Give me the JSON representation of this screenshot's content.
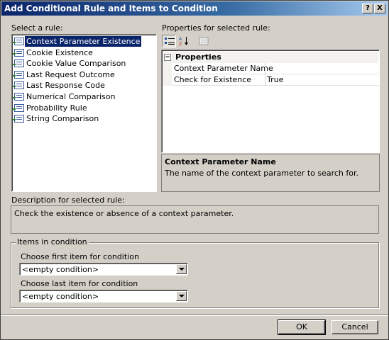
{
  "window": {
    "title": "Add Conditional Rule and Items to Condition",
    "help_button": "?",
    "close_button": "X"
  },
  "rules": {
    "label": "Select a rule:",
    "items": [
      {
        "label": "Context Parameter Existence",
        "selected": true
      },
      {
        "label": "Cookie Existence"
      },
      {
        "label": "Cookie Value Comparison"
      },
      {
        "label": "Last Request Outcome"
      },
      {
        "label": "Last Response Code"
      },
      {
        "label": "Numerical Comparison"
      },
      {
        "label": "Probability Rule"
      },
      {
        "label": "String Comparison"
      }
    ]
  },
  "properties": {
    "label": "Properties for selected rule:",
    "toolbar": [
      "categorized-icon",
      "alphabetical-icon",
      "property-pages-icon"
    ],
    "category": "Properties",
    "expander": "−",
    "rows": [
      {
        "name": "Context Parameter Name",
        "value": ""
      },
      {
        "name": "Check for Existence",
        "value": "True"
      }
    ],
    "help_title": "Context Parameter Name",
    "help_text": "The name of the context parameter to search for."
  },
  "description": {
    "label": "Description for selected rule:",
    "text": "Check the existence or absence of a context parameter."
  },
  "items_in_condition": {
    "group_label": "Items in condition",
    "first_label": "Choose first item for condition",
    "first_value": "<empty condition>",
    "last_label": "Choose last item for condition",
    "last_value": "<empty condition>"
  },
  "buttons": {
    "ok": "OK",
    "cancel": "Cancel"
  }
}
